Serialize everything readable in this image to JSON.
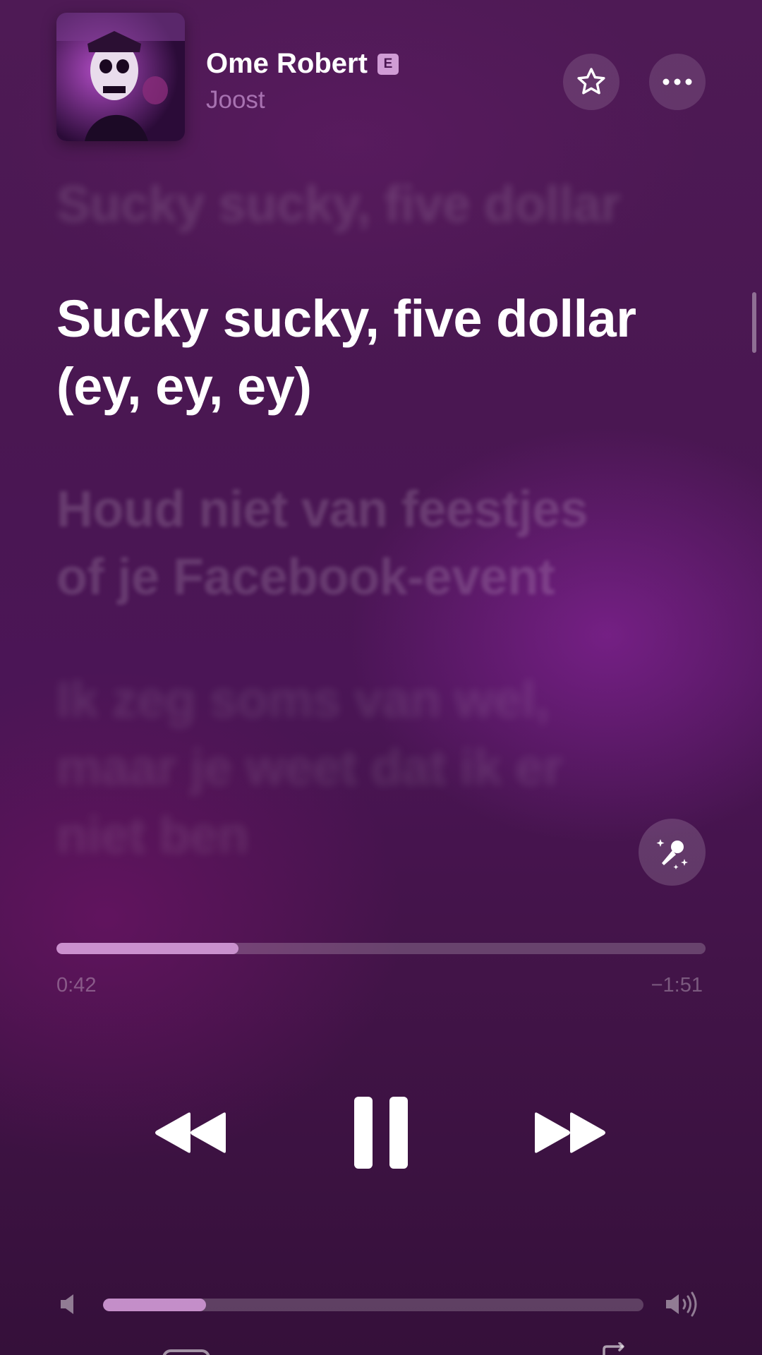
{
  "colors": {
    "background": "#4a1752",
    "accent": "#e6aaeb",
    "text_primary": "#ffffff"
  },
  "header": {
    "title": "Ome Robert",
    "explicit_badge": "E",
    "artist": "Joost",
    "favorite_icon": "star-icon",
    "more_icon": "ellipsis-icon"
  },
  "lyrics": {
    "past": "Sucky sucky, five dollar",
    "current": [
      "Sucky sucky, five dollar",
      "(ey, ey, ey)"
    ],
    "next": [
      "Houd niet van feestjes",
      "of je Facebook-event"
    ],
    "later": [
      "Ik zeg soms van wel,",
      "maar je weet dat ik er",
      "niet ben"
    ]
  },
  "sing_button_icon": "microphone-sparkle-icon",
  "playback": {
    "elapsed": "0:42",
    "remaining": "−1:51",
    "progress_fraction": 0.28
  },
  "controls": {
    "rewind_icon": "rewind-icon",
    "pause_icon": "pause-icon",
    "forward_icon": "fast-forward-icon"
  },
  "volume": {
    "level_fraction": 0.19,
    "low_icon": "speaker-low-icon",
    "high_icon": "speaker-high-icon"
  }
}
